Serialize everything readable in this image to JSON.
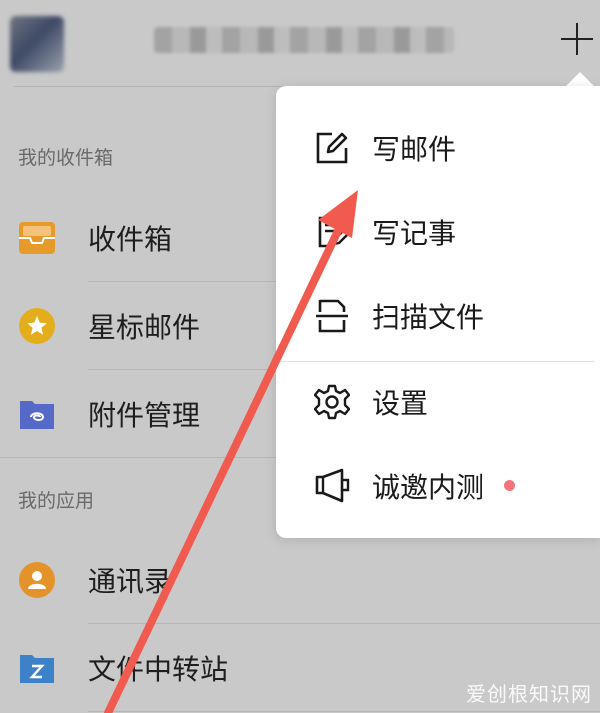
{
  "colors": {
    "background": "#c9c9c9",
    "menu_background": "#ffffff",
    "inbox_icon": "#e59a2a",
    "starred_icon": "#e3ad1c",
    "attachments_icon": "#5469c8",
    "contacts_icon": "#e3932a",
    "file_transfer_icon": "#3d82c8",
    "arrow": "#f05a4f",
    "new_dot": "#f4727a"
  },
  "sidebar": {
    "section_mailboxes": "我的收件箱",
    "mailboxes": [
      {
        "label": "收件箱",
        "icon": "inbox-icon"
      },
      {
        "label": "星标邮件",
        "icon": "star-icon"
      },
      {
        "label": "附件管理",
        "icon": "attachment-folder-icon"
      }
    ],
    "section_apps": "我的应用",
    "apps": [
      {
        "label": "通讯录",
        "icon": "contacts-icon"
      },
      {
        "label": "文件中转站",
        "icon": "file-transfer-icon"
      }
    ]
  },
  "menu": {
    "items": [
      {
        "label": "写邮件",
        "icon": "compose-icon"
      },
      {
        "label": "写记事",
        "icon": "note-icon"
      },
      {
        "label": "扫描文件",
        "icon": "scan-icon"
      },
      {
        "label": "设置",
        "icon": "gear-icon"
      },
      {
        "label": "诚邀内测",
        "icon": "megaphone-icon"
      }
    ]
  },
  "watermark": "爱创根知识网"
}
